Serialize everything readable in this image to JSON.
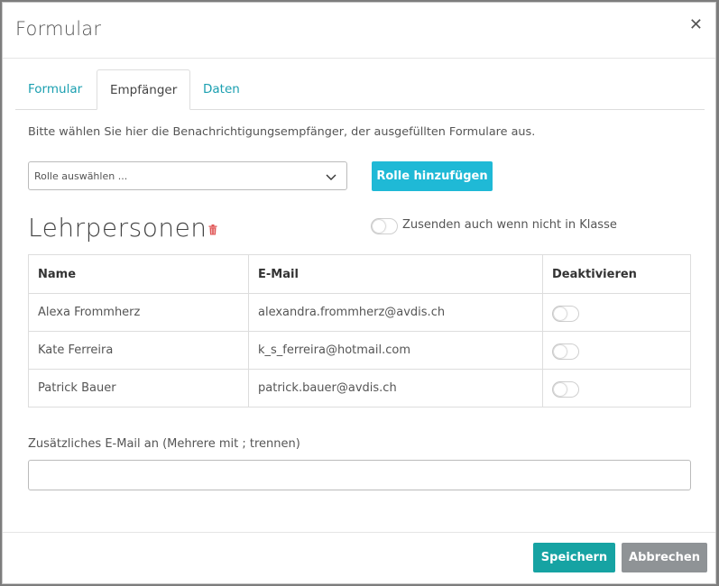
{
  "modal": {
    "title": "Formular",
    "close_icon": "close-icon"
  },
  "tabs": [
    {
      "label": "Formular",
      "active": false
    },
    {
      "label": "Empfänger",
      "active": true
    },
    {
      "label": "Daten",
      "active": false
    }
  ],
  "recipients": {
    "intro": "Bitte wählen Sie hier die Benachrichtigungsempfänger, der ausgefüllten Formulare aus.",
    "role_select": {
      "value": "Rolle auswählen ...",
      "icon": "chevron-down-icon"
    },
    "add_role_label": "Rolle hinzufügen",
    "section_title": "Lehrpersonen",
    "section_delete_icon": "trash-icon",
    "send_anyway_label": "Zusenden auch wenn nicht in Klasse",
    "send_anyway_enabled": false,
    "table": {
      "headers": [
        "Name",
        "E-Mail",
        "Deaktivieren"
      ],
      "rows": [
        {
          "name": "Alexa Frommherz",
          "email": "alexandra.frommherz@avdis.ch",
          "deactivated": false
        },
        {
          "name": "Kate Ferreira",
          "email": "k_s_ferreira@hotmail.com",
          "deactivated": false
        },
        {
          "name": "Patrick Bauer",
          "email": "patrick.bauer@avdis.ch",
          "deactivated": false
        }
      ]
    },
    "extra_email": {
      "label": "Zusätzliches E-Mail an (Mehrere mit ; trennen)",
      "value": "",
      "placeholder": ""
    }
  },
  "footer": {
    "save_label": "Speichern",
    "cancel_label": "Abbrechen"
  },
  "colors": {
    "accent": "#1fb9d6",
    "save": "#16a3a3",
    "cancel": "#8f9396",
    "tab_link": "#1a9fb0",
    "delete": "#e05555"
  }
}
